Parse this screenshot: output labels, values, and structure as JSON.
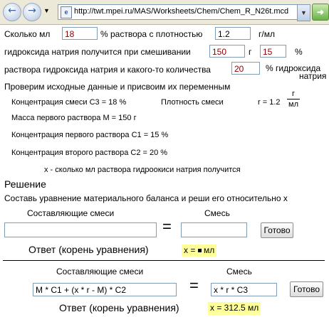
{
  "browser": {
    "url": "http://twt.mpei.ru/MAS/Worksheets/Chem/Chem_R_N26t.mcd",
    "back_icon": "back-arrow-icon",
    "forward_icon": "forward-arrow-icon",
    "go_icon": "go-arrow-icon"
  },
  "problem": {
    "line1_a": "Сколько мл",
    "volume_value": "18",
    "line1_b": "% раствора с плотностью",
    "density_value": "1.2",
    "line1_c": "г/мл",
    "line2_a": "гидроксида натрия получится при смешивании",
    "mass_value": "150",
    "line2_b": "г",
    "conc1_value": "15",
    "line2_c": "%",
    "line3_a": "раствора гидроксида натрия и какого-то количества",
    "conc2_value": "20",
    "line3_b": "% гидроксида",
    "line3_c": "натрия"
  },
  "check": {
    "heading": "Проверим исходные данные и присвоим их переменным",
    "c3": "Концентрация смеси   C3 = 18 %",
    "density_label": "Плотность смеси",
    "r_label": "r = 1.2",
    "frac_num": "г",
    "frac_den": "мл",
    "m": "Масса первого раствора M = 150 г",
    "c1": "Концентрация первого раствора  C1 = 15 %",
    "c2": "Концентрация второго раствора   C2 = 20 %",
    "x_def": "x - сколько мл раствора гидроокиси натрия получится"
  },
  "solution": {
    "heading": "Решение",
    "instruction": "Составь уравнение материального баланса и реши его относительно x",
    "components_label": "Составляющие смеси",
    "mixture_label": "Смесь",
    "left_input": "",
    "right_input": "",
    "equals": "=",
    "button_label": "Готово",
    "answer_label": "Ответ (корень уравнения)",
    "answer_prefix": "x =",
    "answer_suffix": "мл"
  },
  "example": {
    "components_label": "Составляющие смеси",
    "mixture_label": "Смесь",
    "left_value": "M * C1 + (x * r - M) * C2",
    "right_value": "x * r * C3",
    "equals": "=",
    "button_label": "Готово",
    "answer_label": "Ответ (корень уравнения)",
    "answer_value": "x = 312.5 мл"
  }
}
